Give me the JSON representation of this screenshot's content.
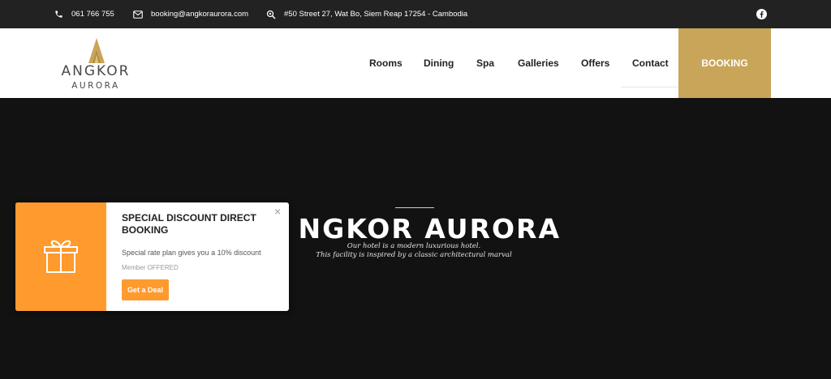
{
  "topbar": {
    "phone": "061 766 755",
    "email": "booking@angkoraurora.com",
    "address": "#50 Street 27, Wat Bo, Siem Reap 17254 - Cambodia",
    "icons": [
      "phone-icon",
      "mail-icon",
      "location-icon",
      "facebook-icon"
    ]
  },
  "logo": {
    "name": "ANGKOR",
    "sub": "AURORA"
  },
  "nav": {
    "items": [
      "Rooms",
      "Dining",
      "Spa",
      "Galleries",
      "Offers",
      "Contact"
    ],
    "booking_label": "BOOKING"
  },
  "hero": {
    "title": "NGKOR AURORA",
    "subtitle_line1": "Our hotel is a modern luxurious hotel.",
    "subtitle_line2": "This facility is inspired by a classic architectural marval"
  },
  "popup": {
    "title": "SPECIAL DISCOUNT DIRECT BOOKING",
    "description": "Special rate plan gives you a 10% discount",
    "meta": "Member OFFERED",
    "button_label": "Get a Deal",
    "close_label": "×"
  },
  "colors": {
    "topbar_bg": "#222222",
    "gold": "#c9a55a",
    "hero_bg": "#121212",
    "popup_accent": "#ff9a2e"
  }
}
